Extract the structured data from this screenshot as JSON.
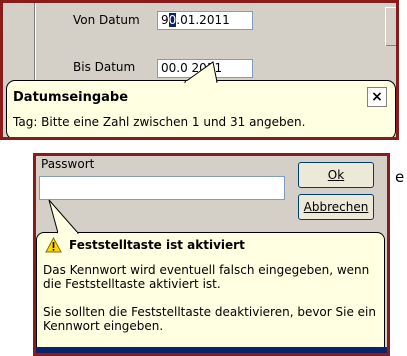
{
  "panel1": {
    "von_datum_label": "Von Datum",
    "von_datum_value_selected": "9",
    "von_datum_value_caret": "0",
    "von_datum_value_rest": ".01.2011",
    "bis_datum_label": "Bis Datum",
    "bis_datum_value": "00.0 2011",
    "tooltip": {
      "title": "Datumseingabe",
      "text": "Tag: Bitte eine Zahl zwischen 1 und 31 angeben.",
      "close": "×"
    }
  },
  "panel2": {
    "passwort_label": "Passwort",
    "ok_button": "Ok",
    "abbrechen_button": "Abbrechen",
    "tooltip": {
      "title": "Feststelltaste ist aktiviert",
      "line1": "Das Kennwort wird eventuell falsch eingegeben, wenn die Feststelltaste aktiviert ist.",
      "line2": "Sie sollten die Feststelltaste deaktivieren, bevor Sie ein Kennwort eingeben."
    }
  },
  "side_chars": {
    "top": "e"
  },
  "colors": {
    "frame": "#8b1a1a",
    "tooltip_bg": "#ffffe1",
    "selection": "#0a246a",
    "dialog_bg": "#d4d0c8"
  }
}
